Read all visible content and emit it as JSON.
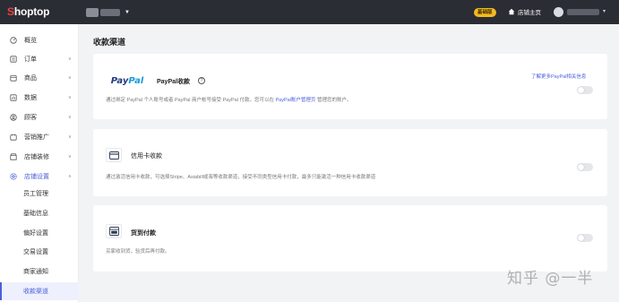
{
  "brand": {
    "logo_first": "S",
    "logo_rest": "hoptop"
  },
  "topbar": {
    "plan_badge": "基础版",
    "store_home": "店铺主页"
  },
  "sidebar": {
    "items": [
      {
        "label": "概览",
        "icon": "dashboard-icon"
      },
      {
        "label": "订单",
        "icon": "order-icon",
        "chevron": "∨"
      },
      {
        "label": "商品",
        "icon": "product-icon",
        "chevron": "∨"
      },
      {
        "label": "数据",
        "icon": "data-icon",
        "chevron": "∨"
      },
      {
        "label": "顾客",
        "icon": "customer-icon",
        "chevron": "∨"
      },
      {
        "label": "营销推广",
        "icon": "marketing-icon",
        "chevron": "∨"
      },
      {
        "label": "店铺装修",
        "icon": "decoration-icon",
        "chevron": "∨"
      },
      {
        "label": "店铺设置",
        "icon": "settings-icon",
        "chevron": "∧"
      }
    ],
    "sub_items": [
      "员工管理",
      "基础信息",
      "偏好设置",
      "交易设置",
      "商家通知",
      "收款渠道"
    ]
  },
  "page": {
    "title": "收款渠道"
  },
  "paypal": {
    "logo_a": "Pay",
    "logo_b": "Pal",
    "title": "PayPal收款",
    "help": "?",
    "desc_a": "通过绑定 PayPal 个人账号或者 PayPal 商户帐号接受 PayPal 付款。您可以在",
    "desc_link": "PayPal账户管理页",
    "desc_b": "管理您的账户。",
    "learn_more": "了解更多PayPal相关信息",
    "enabled": false
  },
  "credit_card": {
    "title": "信用卡收款",
    "desc": "通过激活信用卡收款，可选择Stripe、Asiabill或海等收款渠道，接受不同类型信用卡付款，最多只能激活一种信用卡收款渠道",
    "enabled": false
  },
  "cod": {
    "title": "货到付款",
    "desc": "买家收到货，验货后再付款。",
    "enabled": false
  },
  "watermark": "知乎 @一半",
  "colors": {
    "accent": "#4b5fd8",
    "topbar": "#2b2d35",
    "badge": "#f5b921"
  }
}
